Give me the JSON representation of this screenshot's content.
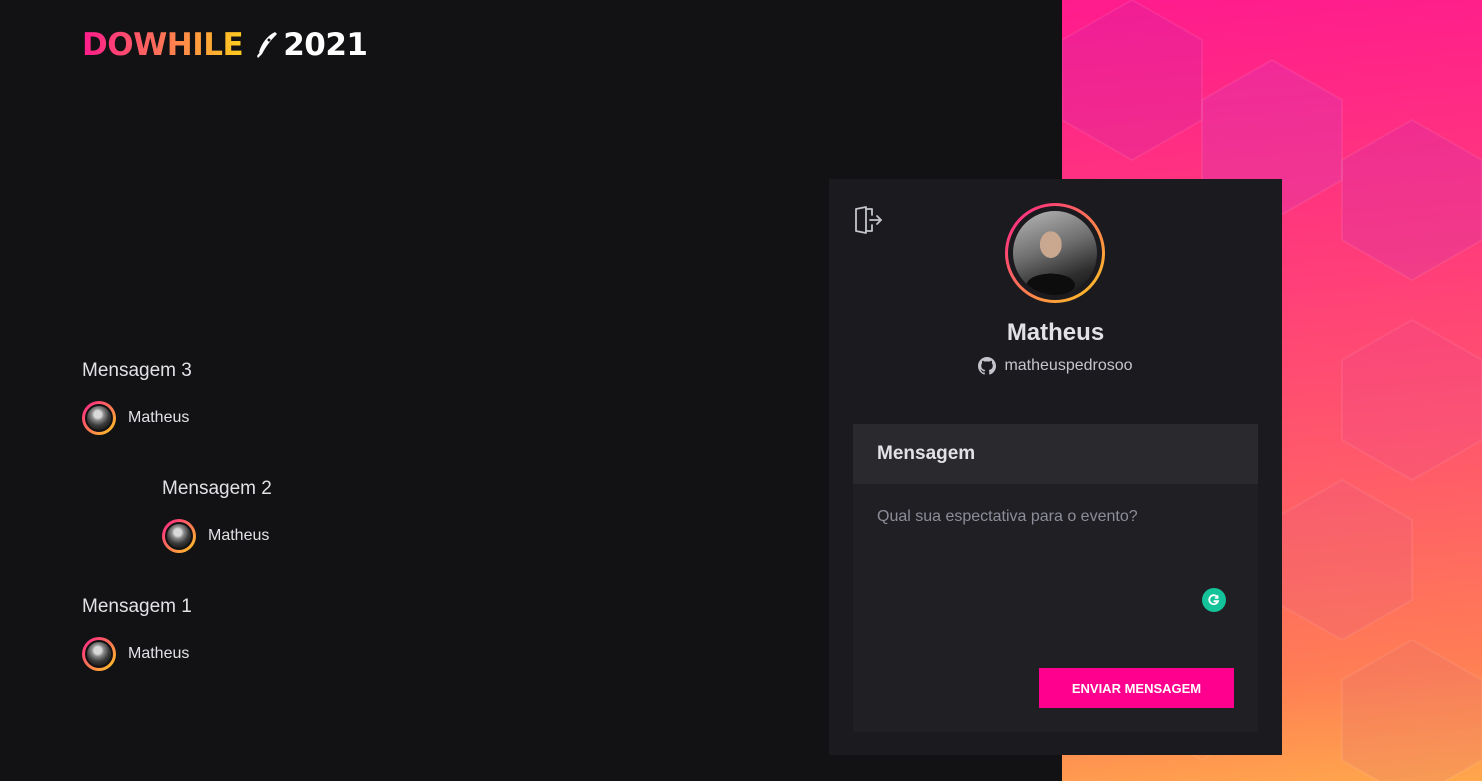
{
  "brand": {
    "word": "DOWHILE",
    "year": "2021",
    "gradient_start": "#ff1b8d",
    "gradient_end": "#ffcd1e"
  },
  "messages": [
    {
      "text": "Mensagem 3",
      "user": "Matheus"
    },
    {
      "text": "Mensagem 2",
      "user": "Matheus"
    },
    {
      "text": "Mensagem 1",
      "user": "Matheus"
    }
  ],
  "profile": {
    "name": "Matheus",
    "login": "matheuspedrosoo",
    "signout_icon": "sign-out-icon",
    "github_icon": "github-icon"
  },
  "form": {
    "label": "Mensagem",
    "placeholder": "Qual sua espectativa para o evento?",
    "submit_label": "ENVIAR MENSAGEM",
    "submit_color": "#ff008e"
  },
  "colors": {
    "background": "#121214",
    "card": "#1b1b1f"
  }
}
